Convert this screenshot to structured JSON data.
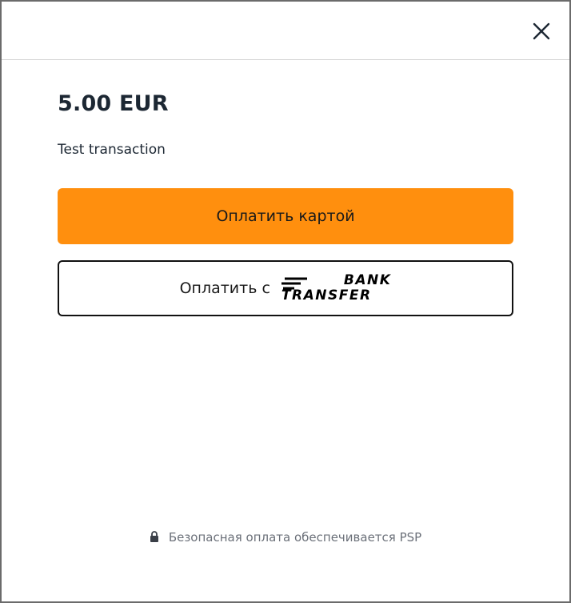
{
  "payment": {
    "amount": "5.00 EUR",
    "description": "Test transaction"
  },
  "buttons": {
    "pay_card_label": "Оплатить картой",
    "pay_bank_label": "Оплатить с",
    "bank_logo_line1": "BANK",
    "bank_logo_line2": "TRANSFER"
  },
  "footer": {
    "secure_text": "Безопасная оплата обеспечивается PSP"
  },
  "icons": {
    "close": "close-icon",
    "lock": "lock-icon",
    "bank_transfer_logo": "bank-transfer-logo"
  },
  "colors": {
    "primary_button": "#ff8f0e",
    "text_dark": "#1c2733",
    "text_muted": "#6b7079"
  }
}
